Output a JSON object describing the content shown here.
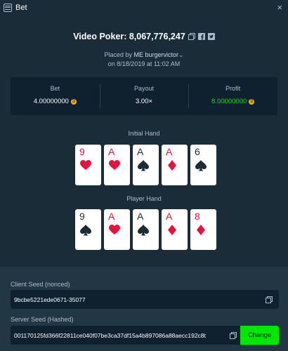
{
  "window": {
    "title": "Bet",
    "close": "×"
  },
  "header": {
    "title": "Video Poker: 8,067,776,247",
    "placed_prefix": "Placed by ",
    "user_badge": "ME",
    "username": "burgervictor",
    "date_line": "on 8/18/2019 at 11:02 AM"
  },
  "stats": {
    "bet_label": "Bet",
    "bet_value": "4.00000000",
    "payout_label": "Payout",
    "payout_value": "3.00×",
    "profit_label": "Profit",
    "profit_value": "8.00000000",
    "coin_symbol": "₿"
  },
  "initial_hand": {
    "label": "Initial Hand",
    "cards": [
      {
        "rank": "9",
        "suit": "heart"
      },
      {
        "rank": "A",
        "suit": "heart"
      },
      {
        "rank": "A",
        "suit": "spade"
      },
      {
        "rank": "A",
        "suit": "diamond"
      },
      {
        "rank": "6",
        "suit": "spade"
      }
    ]
  },
  "player_hand": {
    "label": "Player Hand",
    "cards": [
      {
        "rank": "9",
        "suit": "spade"
      },
      {
        "rank": "A",
        "suit": "heart"
      },
      {
        "rank": "A",
        "suit": "spade"
      },
      {
        "rank": "A",
        "suit": "diamond"
      },
      {
        "rank": "8",
        "suit": "diamond"
      }
    ]
  },
  "seeds": {
    "client_label": "Client Seed (nonced)",
    "client_value": "9bcbe5221ede0671-35077",
    "server_label": "Server Seed (Hashed)",
    "server_value": "001170125fd366f22811ce040f07be3ca37df15a4b897086a88aecc192c8t",
    "change_label": "Change"
  },
  "colors": {
    "background": "#1a2c38",
    "panel": "#0f212e",
    "accent_green": "#00e701",
    "red_suit": "#e9113c"
  }
}
